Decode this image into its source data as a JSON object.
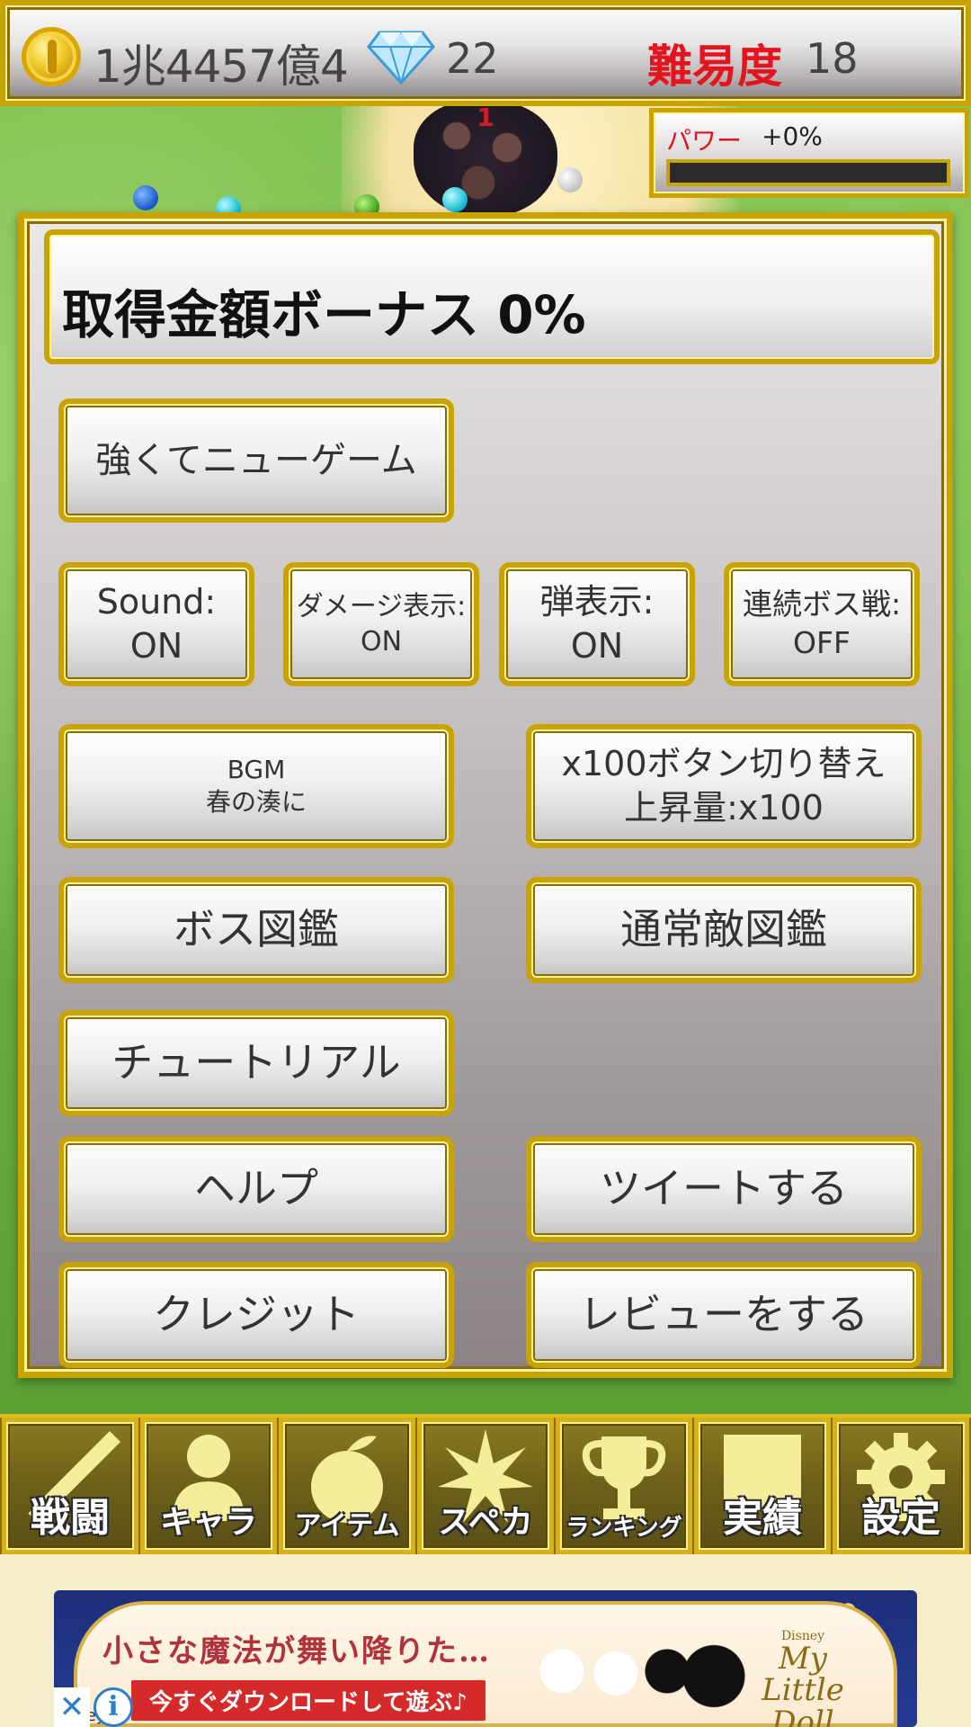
{
  "status_bar": {
    "money": "1兆4457億4",
    "gems": "22",
    "difficulty_label": "難易度",
    "difficulty_value": "18"
  },
  "power": {
    "label": "パワー",
    "value": "+0%",
    "level": 0
  },
  "battlefield": {
    "boss_damage_text": "1"
  },
  "settings_panel": {
    "bonus_text": "取得金額ボーナス 0%",
    "new_game_button": "強くてニューゲーム",
    "toggles": [
      {
        "label": "Sound:",
        "value": "ON"
      },
      {
        "label": "ダメージ表示:",
        "value": "ON"
      },
      {
        "label": "弾表示:",
        "value": "ON"
      },
      {
        "label": "連続ボス戦:",
        "value": "OFF"
      }
    ],
    "bgm_button": {
      "line1": "BGM",
      "line2": "春の湊に"
    },
    "x100_button": {
      "line1": "x100ボタン切り替え",
      "line2": "上昇量:x100"
    },
    "boss_encyclopedia_button": "ボス図鑑",
    "enemy_encyclopedia_button": "通常敵図鑑",
    "tutorial_button": "チュートリアル",
    "help_button": "ヘルプ",
    "tweet_button": "ツイートする",
    "credit_button": "クレジット",
    "review_button": "レビューをする"
  },
  "bottom_nav": {
    "tabs": [
      {
        "label": "戦闘",
        "icon": "sword-icon"
      },
      {
        "label": "キャラ",
        "icon": "person-icon"
      },
      {
        "label": "アイテム",
        "icon": "fruit-bag-icon"
      },
      {
        "label": "スペカ",
        "icon": "star-burst-icon"
      },
      {
        "label": "ランキング",
        "icon": "trophy-icon"
      },
      {
        "label": "実績",
        "icon": "square-icon"
      },
      {
        "label": "設定",
        "icon": "gear-icon"
      }
    ]
  },
  "ad": {
    "headline": "小さな魔法が舞い降りた…",
    "cta": "今すぐダウンロードして遊ぶ♪",
    "brand_small": "Disney",
    "brand": "My Little Doll",
    "footer": "isney"
  },
  "colors": {
    "gold_border": "#c9a400",
    "difficulty_red": "#e4141e",
    "nav_icon": "#f4ee9a"
  }
}
